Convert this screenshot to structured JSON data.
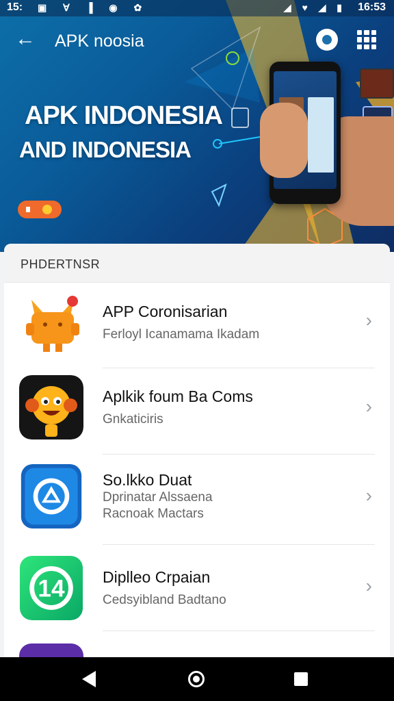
{
  "status_bar": {
    "time_left": "15:",
    "time_right": "16:53"
  },
  "app_bar": {
    "title": "APK noosia"
  },
  "hero": {
    "headline": "APK INDONESIA",
    "subline": "AND INDONESIA"
  },
  "section": {
    "title": "PHDERTNSR"
  },
  "apps": [
    {
      "title": "APP Coronisarian",
      "subtitle": "Ferloyl Icanamama Ikadam",
      "icon": "cat-robot-icon"
    },
    {
      "title": "Aplkik foum Ba Coms",
      "subtitle": "Gnkaticiris",
      "icon": "smiley-character-icon"
    },
    {
      "title": "So.lkko Duat",
      "subtitle": "Dprinatar Alssaena",
      "subtitle2": "Racnoak Mactars",
      "icon": "triangle-logo-icon"
    },
    {
      "title": "Diplleo Crpaian",
      "subtitle": "Cedsyibland Badtano",
      "icon": "plus-circle-icon"
    }
  ],
  "colors": {
    "accent": "#0b5b99",
    "chevron": "#9aa0a6"
  }
}
